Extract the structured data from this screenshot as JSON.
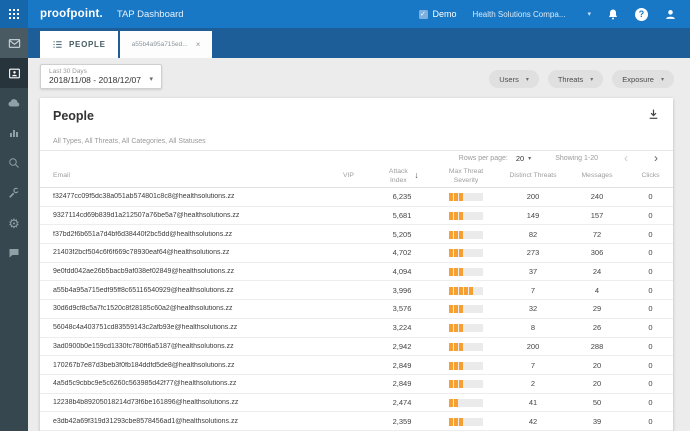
{
  "header": {
    "logo": "proofpoint.",
    "app_title": "TAP Dashboard",
    "demo_label": "Demo",
    "org": "Health Solutions Compa..."
  },
  "glyphs": {
    "caret": "▾",
    "check": "✓",
    "question": "?",
    "close": "×",
    "sort_desc": "↓",
    "prev": "‹",
    "next": "›",
    "gear": "⚙"
  },
  "sidebar": {
    "items": [
      {
        "icon": "mail-icon"
      },
      {
        "icon": "people-badge-icon",
        "active": true
      },
      {
        "icon": "cloud-icon"
      },
      {
        "icon": "bar-chart-icon"
      },
      {
        "icon": "search-icon"
      },
      {
        "icon": "wrench-icon"
      },
      {
        "icon": "gear-icon"
      },
      {
        "icon": "chat-icon"
      }
    ]
  },
  "tabs": [
    {
      "label": "PEOPLE",
      "icon": "list-icon",
      "active": true
    },
    {
      "label": "a55b4a95a715ed...",
      "close": "×",
      "active": false
    }
  ],
  "filters": {
    "date_label": "Last 30 Days",
    "date_range": "2018/11/08 - 2018/12/07",
    "buttons": [
      {
        "label": "Users"
      },
      {
        "label": "Threats"
      },
      {
        "label": "Exposure"
      }
    ]
  },
  "card": {
    "title": "People",
    "subtitle": "All Types, All Threats, All Categories, All Statuses",
    "pagination": {
      "rows_per_page_label": "Rows per page:",
      "rows_per_page_value": "20",
      "showing": "Showing 1-20"
    },
    "table": {
      "columns": [
        "Email",
        "VIP",
        "Attack Index",
        "Max Threat Severity",
        "Distinct Threats",
        "Messages",
        "Clicks"
      ],
      "sort_column": "Attack Index",
      "sort_direction": "desc",
      "severity_color": "#F5A033",
      "rows": [
        {
          "email": "f32477cc09f5dc38a051ab574801c8c8@healthsolutions.zz",
          "vip": "",
          "attack_index": "6,235",
          "severity_filled": 3,
          "severity_total": 7,
          "distinct_threats": "200",
          "messages": "240",
          "clicks": "0"
        },
        {
          "email": "9327114cd69b839d1a212507a76be5a7@healthsolutions.zz",
          "vip": "",
          "attack_index": "5,681",
          "severity_filled": 3,
          "severity_total": 7,
          "distinct_threats": "149",
          "messages": "157",
          "clicks": "0"
        },
        {
          "email": "f37bd2f6b651a7d4bf6d38440f2bc5dd@healthsolutions.zz",
          "vip": "",
          "attack_index": "5,205",
          "severity_filled": 3,
          "severity_total": 7,
          "distinct_threats": "82",
          "messages": "72",
          "clicks": "0"
        },
        {
          "email": "21403f2bcf504c6f6f669c78930eaf64@healthsolutions.zz",
          "vip": "",
          "attack_index": "4,702",
          "severity_filled": 3,
          "severity_total": 7,
          "distinct_threats": "273",
          "messages": "306",
          "clicks": "0"
        },
        {
          "email": "9e0fdd042ae26b5bacb9af038ef02849@healthsolutions.zz",
          "vip": "",
          "attack_index": "4,094",
          "severity_filled": 3,
          "severity_total": 7,
          "distinct_threats": "37",
          "messages": "24",
          "clicks": "0"
        },
        {
          "email": "a55b4a95a715edf95ff8c65116540929@healthsolutions.zz",
          "vip": "",
          "attack_index": "3,996",
          "severity_filled": 5,
          "severity_total": 7,
          "distinct_threats": "7",
          "messages": "4",
          "clicks": "0"
        },
        {
          "email": "30d6d9cf8c5a7fc1520c8f28185c60a2@healthsolutions.zz",
          "vip": "",
          "attack_index": "3,576",
          "severity_filled": 3,
          "severity_total": 7,
          "distinct_threats": "32",
          "messages": "29",
          "clicks": "0"
        },
        {
          "email": "56048c4a403751cd83559143c2afb93e@healthsolutions.zz",
          "vip": "",
          "attack_index": "3,224",
          "severity_filled": 3,
          "severity_total": 7,
          "distinct_threats": "8",
          "messages": "26",
          "clicks": "0"
        },
        {
          "email": "3ad0900b0e159cd1330fc780ff6a5187@healthsolutions.zz",
          "vip": "",
          "attack_index": "2,942",
          "severity_filled": 3,
          "severity_total": 7,
          "distinct_threats": "200",
          "messages": "288",
          "clicks": "0"
        },
        {
          "email": "170267b7e87d3beb3f0fb184ddfd5de8@healthsolutions.zz",
          "vip": "",
          "attack_index": "2,849",
          "severity_filled": 3,
          "severity_total": 7,
          "distinct_threats": "7",
          "messages": "20",
          "clicks": "0"
        },
        {
          "email": "4a5d5c9cbbc9e5c6260c563985d42f77@healthsolutions.zz",
          "vip": "",
          "attack_index": "2,849",
          "severity_filled": 3,
          "severity_total": 7,
          "distinct_threats": "2",
          "messages": "20",
          "clicks": "0"
        },
        {
          "email": "12238b4b89205018214d73f6be161896@healthsolutions.zz",
          "vip": "",
          "attack_index": "2,474",
          "severity_filled": 2,
          "severity_total": 7,
          "distinct_threats": "41",
          "messages": "50",
          "clicks": "0"
        },
        {
          "email": "e3db42a69f319d31293cbe8578456ad1@healthsolutions.zz",
          "vip": "",
          "attack_index": "2,359",
          "severity_filled": 3,
          "severity_total": 7,
          "distinct_threats": "42",
          "messages": "39",
          "clicks": "0"
        }
      ]
    }
  },
  "colors": {
    "header_blue": "#1878c5",
    "tabbar_blue": "#1d5e98",
    "sidebar_dark": "#37474f",
    "severity_orange": "#F5A033",
    "background": "#ececec"
  }
}
